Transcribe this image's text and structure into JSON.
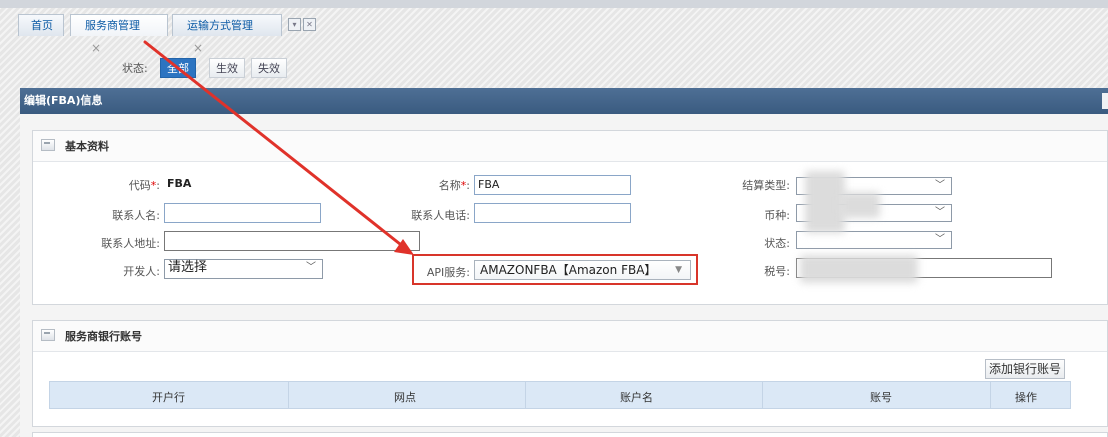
{
  "tabs": {
    "home": "首页",
    "service": "服务商管理",
    "shipping": "运输方式管理",
    "close_glyph": "×"
  },
  "filter": {
    "label": "状态:",
    "options": [
      "全部",
      "生效",
      "失效"
    ],
    "active": "全部"
  },
  "panel": {
    "title": "编辑(FBA)信息"
  },
  "basic": {
    "title": "基本资料",
    "code_label": "代码",
    "code_value": "FBA",
    "name_label": "名称",
    "name_value": "FBA",
    "settle_label": "结算类型:",
    "contact_label": "联系人名:",
    "contact_value": "",
    "phone_label": "联系人电话:",
    "phone_value": "",
    "currency_label": "币种:",
    "address_label": "联系人地址:",
    "address_value": "",
    "status_label": "状态:",
    "developer_label": "开发人:",
    "developer_value": "请选择",
    "api_label": "API服务:",
    "api_value": "AMAZONFBA【Amazon FBA】",
    "tax_label": "税号:",
    "required_mark": "*",
    "colon": ":"
  },
  "bank": {
    "title": "服务商银行账号",
    "add_button": "添加银行账号",
    "columns": [
      "开户行",
      "网点",
      "账户名",
      "账号",
      "操作"
    ]
  },
  "colors": {
    "accent": "#2d74c1",
    "header": "#3d5f86",
    "highlight": "#d8352a",
    "arrow": "#e0322a"
  }
}
